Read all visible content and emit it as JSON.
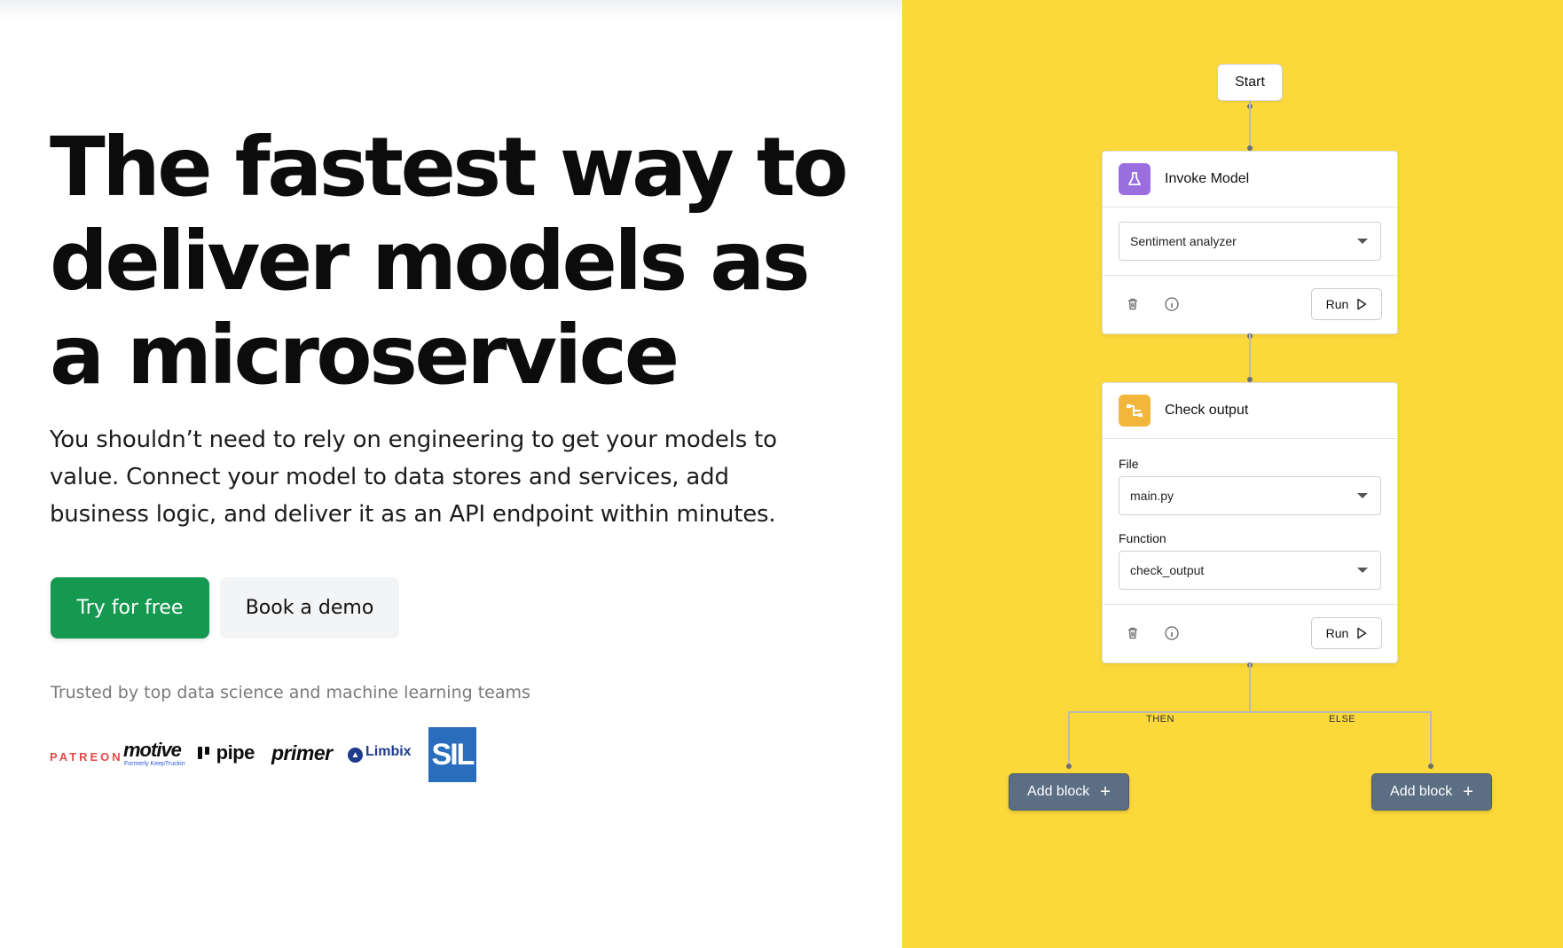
{
  "hero": {
    "headline": "The fastest way to deliver models as a microservice",
    "subtext": "You shouldn’t need to rely on engineering to get your models to value. Connect your model to data stores and services, add business logic, and deliver it as an API endpoint within minutes.",
    "primary_cta": "Try for free",
    "secondary_cta": "Book a demo",
    "trusted_text": "Trusted by top data science and machine learning teams"
  },
  "logos": {
    "patreon": "PATREON",
    "motive": "motive",
    "motive_sub": "Formerly KeepTruckin",
    "pipe": "pipe",
    "primer": "primer",
    "limbix": "Limbix",
    "sil": "SIL"
  },
  "workflow": {
    "start_label": "Start",
    "invoke_card": {
      "title": "Invoke Model",
      "icon": "flask-icon",
      "select_value": "Sentiment analyzer",
      "run_label": "Run"
    },
    "check_card": {
      "title": "Check output",
      "icon": "branch-icon",
      "file_label": "File",
      "file_value": "main.py",
      "function_label": "Function",
      "function_value": "check_output",
      "run_label": "Run"
    },
    "then_label": "THEN",
    "else_label": "ELSE",
    "add_block_left": "Add block",
    "add_block_right": "Add block"
  },
  "colors": {
    "primary_green": "#15984f",
    "canvas_yellow": "#fcd93a",
    "invoke_icon_purple": "#9b6ee0",
    "check_icon_orange": "#f2b63c",
    "add_block_slate": "#5c6e84"
  }
}
